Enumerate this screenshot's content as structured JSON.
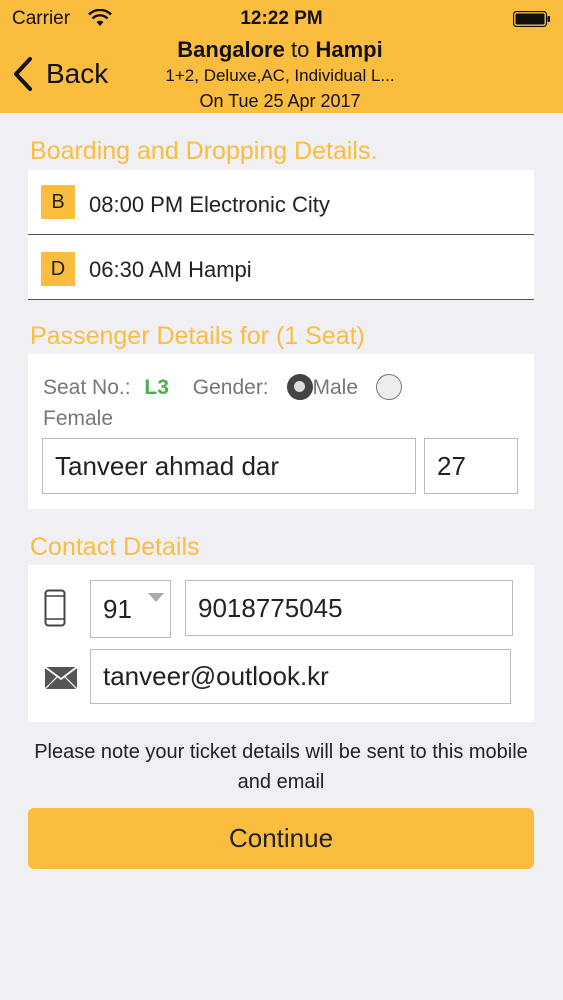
{
  "status_bar": {
    "carrier": "Carrier",
    "time": "12:22 PM"
  },
  "nav": {
    "back_label": "Back",
    "route_from": "Bangalore",
    "route_to_word": "to",
    "route_to": "Hampi",
    "bus_info": "1+2, Deluxe,AC, Individual L...",
    "date": "On Tue 25 Apr 2017"
  },
  "boarding": {
    "section_title": "Boarding and Dropping Details.",
    "stops": [
      {
        "badge": "B",
        "text": "08:00 PM Electronic City"
      },
      {
        "badge": "D",
        "text": "06:30 AM Hampi"
      }
    ]
  },
  "passenger": {
    "section_title": "Passenger Details for (1 Seat)",
    "seat_label": "Seat No.:",
    "seat_value": "L3",
    "gender_label": "Gender:",
    "gender_options": [
      "Male",
      "Female"
    ],
    "selected_gender": "Male",
    "name_value": "Tanveer ahmad dar",
    "age_value": "27"
  },
  "contact": {
    "section_title": "Contact Details",
    "country_code": "91",
    "phone_value": "9018775045",
    "email_value": "tanveer@outlook.kr",
    "icons": [
      "mobile-phone-icon",
      "envelope-icon"
    ]
  },
  "note": "Please note your ticket details will be sent to this mobile and email",
  "continue_label": "Continue",
  "colors": {
    "accent": "#fbbd3d",
    "seat_green": "#4caf50",
    "background": "#efeff4"
  }
}
